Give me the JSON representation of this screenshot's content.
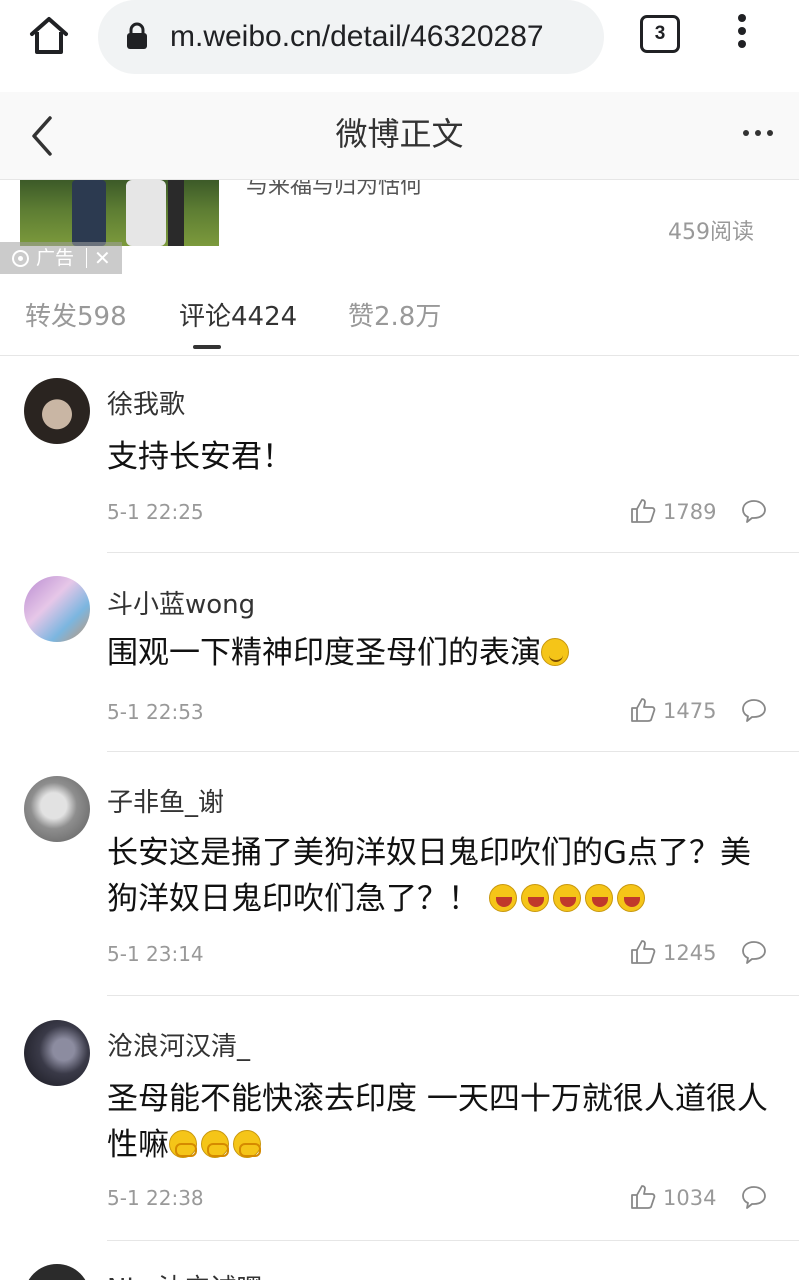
{
  "browser": {
    "url": "m.weibo.cn/detail/46320287",
    "tab_count": "3"
  },
  "header": {
    "title": "微博正文"
  },
  "ad": {
    "text_fragment": "与来福与归为恬何",
    "badge_label": "广告",
    "close_glyph": "✕",
    "read_count": "459阅读"
  },
  "tabs": [
    {
      "label": "转发598",
      "active": false
    },
    {
      "label": "评论4424",
      "active": true
    },
    {
      "label": "赞2.8万",
      "active": false
    }
  ],
  "comments": [
    {
      "user": "徐我歌",
      "text": "支持长安君！",
      "emojis": [],
      "time": "5-1 22:25",
      "likes": "1789"
    },
    {
      "user": "斗小蓝wong",
      "text": "围观一下精神印度圣母们的表演",
      "emojis": [
        "smile"
      ],
      "time": "5-1 22:53",
      "likes": "1475"
    },
    {
      "user": "子非鱼_谢",
      "text": "长安这是捅了美狗洋奴日鬼印吹们的G点了？美狗洋奴日鬼印吹们急了？！",
      "emojis": [
        "laugh",
        "laugh",
        "laugh",
        "laugh",
        "laugh"
      ],
      "time": "5-1 23:14",
      "likes": "1245"
    },
    {
      "user": "沧浪河汉清_",
      "text": "圣母能不能快滚去印度 一天四十万就很人道很人性嘛",
      "emojis": [
        "hands",
        "hands",
        "hands"
      ],
      "time": "5-1 22:38",
      "likes": "1034"
    },
    {
      "user": "Nin 沈宁诚嘿",
      "text": "",
      "emojis": [],
      "time": "",
      "likes": ""
    }
  ],
  "icons": {
    "home": "home-icon",
    "lock": "lock-icon",
    "tabs": "tab-switcher-icon",
    "menu": "overflow-menu-icon",
    "back": "chevron-left-icon",
    "more": "more-horizontal-icon",
    "like": "thumbs-up-icon",
    "reply": "comment-bubble-icon"
  },
  "colors": {
    "text": "#333333",
    "muted": "#999999",
    "divider": "#e6e6e6",
    "header_bg": "#f9f9f9"
  }
}
